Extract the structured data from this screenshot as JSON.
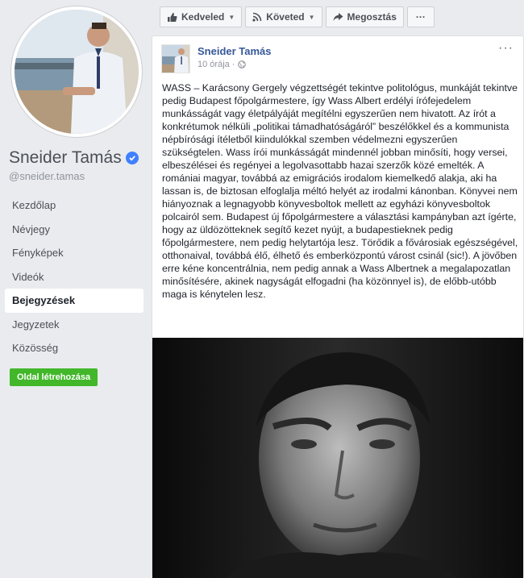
{
  "profile": {
    "name": "Sneider Tamás",
    "handle": "@sneider.tamas"
  },
  "nav": {
    "items": [
      {
        "label": "Kezdőlap"
      },
      {
        "label": "Névjegy"
      },
      {
        "label": "Fényképek"
      },
      {
        "label": "Videók"
      },
      {
        "label": "Bejegyzések",
        "active": true
      },
      {
        "label": "Jegyzetek"
      },
      {
        "label": "Közösség"
      }
    ],
    "create_page_label": "Oldal létrehozása"
  },
  "actions": {
    "like_label": "Kedveled",
    "follow_label": "Követed",
    "share_label": "Megosztás",
    "more_label": "···"
  },
  "post": {
    "author": "Sneider Tamás",
    "time": "10 órája · ",
    "menu": "···",
    "text": "WASS – Karácsony Gergely végzettségét tekintve politológus, munkáját tekintve pedig Budapest főpolgármestere, így Wass Albert erdélyi írófejedelem munkásságát vagy életpályáját megítélni egyszerűen nem hivatott. Az írót a konkrétumok nélküli „politikai támadhatóságáról” beszélőkkel és a kommunista népbírósági ítéletből kiindulókkal szemben védelmezni egyszerűen szükségtelen. Wass írói munkásságát mindennél jobban minősíti, hogy versei, elbeszélései és regényei a legolvasottabb hazai szerzők közé emelték. A romániai magyar, továbbá az emigrációs irodalom kiemelkedő alakja, aki ha lassan is, de biztosan elfoglalja méltó helyét az irodalmi kánonban. Könyvei nem hiányoznak a legnagyobb könyvesboltok mellett az egyházi könyvesboltok polcairól sem. Budapest új főpolgármestere a választási kampányban azt ígérte, hogy az üldözötteknek segítő kezet nyújt, a budapestieknek pedig főpolgármestere, nem pedig helytartója lesz. Törődik a fővárosiak egészségével, otthonaival, továbbá élő, élhető és emberközpontú várost csinál (sic!). A jövőben erre kéne koncentrálnia, nem pedig annak a Wass Albertnek a megalapozatlan minősítésére, akinek nagyságát elfogadni (ha közönnyel is), de előbb-utóbb maga is kénytelen lesz."
  },
  "colors": {
    "page_bg": "#e9ebee",
    "link": "#365899",
    "verified": "#4080ff",
    "create_button": "#42b72a"
  },
  "icons": [
    "like-icon",
    "rss-icon",
    "share-arrow-icon",
    "verified-icon",
    "globe-icon",
    "more-icon",
    "caret-down-icon"
  ]
}
